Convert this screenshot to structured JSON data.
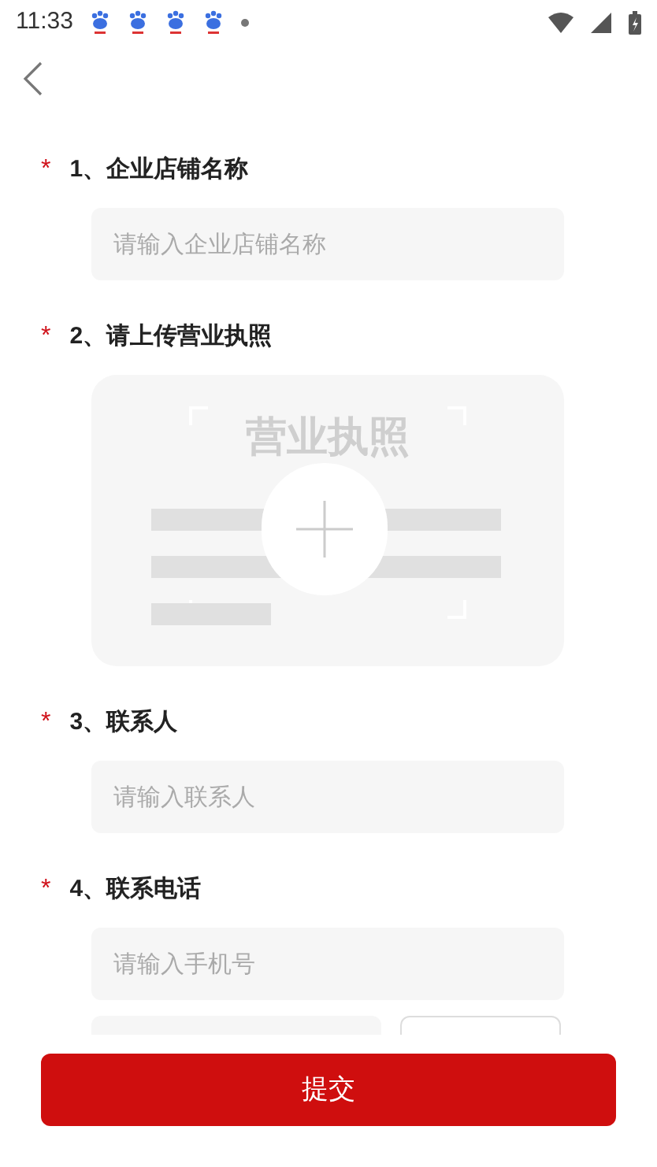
{
  "status_bar": {
    "time": "11:33"
  },
  "form": {
    "fields": [
      {
        "kind": "text",
        "mark": "*",
        "label": "1、企业店铺名称",
        "placeholder": "请输入企业店铺名称"
      },
      {
        "kind": "upload",
        "mark": "*",
        "label": "2、请上传营业执照",
        "sample_title": "营业执照"
      },
      {
        "kind": "text",
        "mark": "*",
        "label": "3、联系人",
        "placeholder": "请输入联系人"
      },
      {
        "kind": "text",
        "mark": "*",
        "label": "4、联系电话",
        "placeholder": "请输入手机号"
      }
    ]
  },
  "submit_button": "提交"
}
